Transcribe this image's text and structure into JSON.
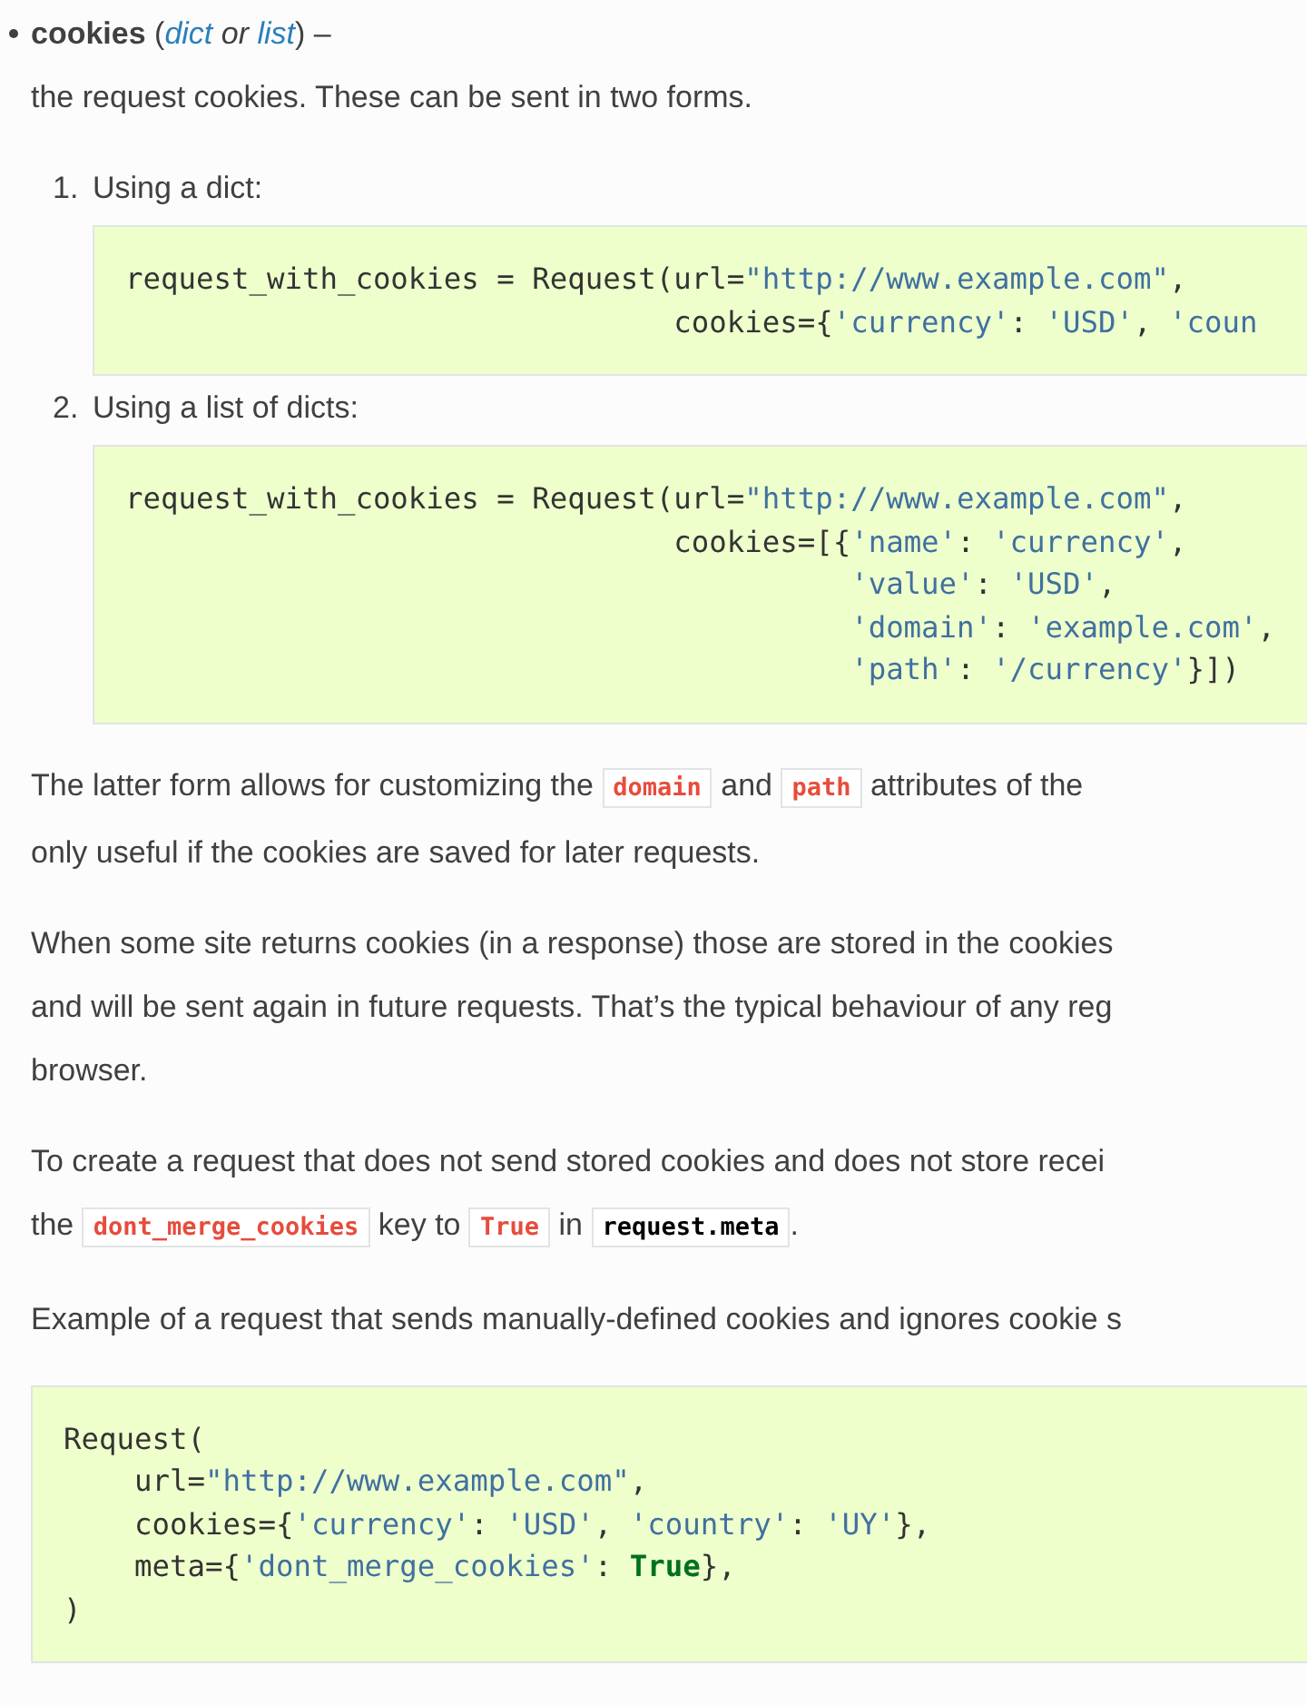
{
  "parameter": {
    "signature": [
      {
        "text": "cookies",
        "kind": "bold"
      },
      {
        "text": " (",
        "kind": "text"
      },
      {
        "text": "dict",
        "kind": "link"
      },
      {
        "text": " or ",
        "kind": "em"
      },
      {
        "text": "list",
        "kind": "link"
      },
      {
        "text": ") –",
        "kind": "text"
      }
    ],
    "description": "the request cookies. These can be sent in two forms.",
    "forms": [
      {
        "number": "1.",
        "label": "Using a dict:",
        "code": [
          [
            {
              "t": "request_with_cookies = Request(url=",
              "kind": "plain"
            },
            {
              "t": "\"http://www.example.com\"",
              "kind": "string"
            },
            {
              "t": ",",
              "kind": "plain"
            }
          ],
          [
            {
              "t": "                               cookies={",
              "kind": "plain"
            },
            {
              "t": "'currency'",
              "kind": "string"
            },
            {
              "t": ": ",
              "kind": "plain"
            },
            {
              "t": "'USD'",
              "kind": "string"
            },
            {
              "t": ", ",
              "kind": "plain"
            },
            {
              "t": "'coun",
              "kind": "string"
            }
          ]
        ]
      },
      {
        "number": "2.",
        "label": "Using a list of dicts:",
        "code": [
          [
            {
              "t": "request_with_cookies = Request(url=",
              "kind": "plain"
            },
            {
              "t": "\"http://www.example.com\"",
              "kind": "string"
            },
            {
              "t": ",",
              "kind": "plain"
            }
          ],
          [
            {
              "t": "                               cookies=[{",
              "kind": "plain"
            },
            {
              "t": "'name'",
              "kind": "string"
            },
            {
              "t": ": ",
              "kind": "plain"
            },
            {
              "t": "'currency'",
              "kind": "string"
            },
            {
              "t": ",",
              "kind": "plain"
            }
          ],
          [
            {
              "t": "                                         'value'",
              "kind": "string"
            },
            {
              "t": ": ",
              "kind": "plain"
            },
            {
              "t": "'USD'",
              "kind": "string"
            },
            {
              "t": ",",
              "kind": "plain"
            }
          ],
          [
            {
              "t": "                                         'domain'",
              "kind": "string"
            },
            {
              "t": ": ",
              "kind": "plain"
            },
            {
              "t": "'example.com'",
              "kind": "string"
            },
            {
              "t": ",",
              "kind": "plain"
            }
          ],
          [
            {
              "t": "                                         'path'",
              "kind": "string"
            },
            {
              "t": ": ",
              "kind": "plain"
            },
            {
              "t": "'/currency'",
              "kind": "string"
            },
            {
              "t": "}])",
              "kind": "plain"
            }
          ]
        ]
      }
    ]
  },
  "paragraphs": [
    {
      "lines": [
        [
          {
            "text": "The latter form allows for customizing the ",
            "kind": "text"
          },
          {
            "text": "domain",
            "kind": "literal"
          },
          {
            "text": " and ",
            "kind": "text"
          },
          {
            "text": "path",
            "kind": "literal"
          },
          {
            "text": " attributes of the",
            "kind": "text"
          }
        ],
        [
          {
            "text": "only useful if the cookies are saved for later requests.",
            "kind": "text"
          }
        ]
      ]
    },
    {
      "lines": [
        [
          {
            "text": "When some site returns cookies (in a response) those are stored in the cookies",
            "kind": "text"
          }
        ],
        [
          {
            "text": "and will be sent again in future requests. That’s the typical behaviour of any reg",
            "kind": "text"
          }
        ],
        [
          {
            "text": "browser.",
            "kind": "text"
          }
        ]
      ]
    },
    {
      "lines": [
        [
          {
            "text": "To create a request that does not send stored cookies and does not store recei",
            "kind": "text"
          }
        ],
        [
          {
            "text": "the ",
            "kind": "text"
          },
          {
            "text": "dont_merge_cookies",
            "kind": "literal"
          },
          {
            "text": " key to ",
            "kind": "text"
          },
          {
            "text": "True",
            "kind": "literal"
          },
          {
            "text": " in ",
            "kind": "text"
          },
          {
            "text": "request.meta",
            "kind": "code"
          },
          {
            "text": ".",
            "kind": "text"
          }
        ]
      ]
    },
    {
      "lines": [
        [
          {
            "text": "Example of a request that sends manually-defined cookies and ignores cookie s",
            "kind": "text"
          }
        ]
      ]
    }
  ],
  "example": {
    "code": [
      [
        {
          "t": "Request(",
          "kind": "plain"
        }
      ],
      [
        {
          "t": "    url=",
          "kind": "plain"
        },
        {
          "t": "\"http://www.example.com\"",
          "kind": "string"
        },
        {
          "t": ",",
          "kind": "plain"
        }
      ],
      [
        {
          "t": "    cookies={",
          "kind": "plain"
        },
        {
          "t": "'currency'",
          "kind": "string"
        },
        {
          "t": ": ",
          "kind": "plain"
        },
        {
          "t": "'USD'",
          "kind": "string"
        },
        {
          "t": ", ",
          "kind": "plain"
        },
        {
          "t": "'country'",
          "kind": "string"
        },
        {
          "t": ": ",
          "kind": "plain"
        },
        {
          "t": "'UY'",
          "kind": "string"
        },
        {
          "t": "},",
          "kind": "plain"
        }
      ],
      [
        {
          "t": "    meta={",
          "kind": "plain"
        },
        {
          "t": "'dont_merge_cookies'",
          "kind": "string"
        },
        {
          "t": ": ",
          "kind": "plain"
        },
        {
          "t": "True",
          "kind": "keyword"
        },
        {
          "t": "},",
          "kind": "plain"
        }
      ],
      [
        {
          "t": ")",
          "kind": "plain"
        }
      ]
    ]
  }
}
